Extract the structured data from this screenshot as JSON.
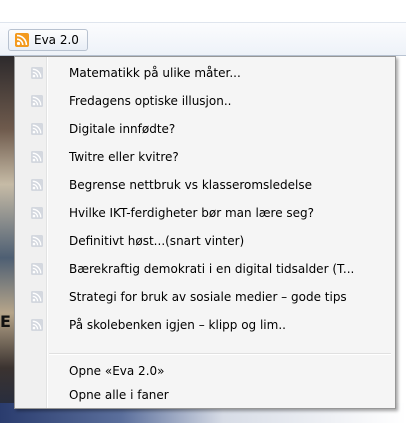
{
  "toolbar": {
    "folder_label": "Eva 2.0",
    "folder_icon": "rss-feed-icon"
  },
  "menu": {
    "items": [
      {
        "label": "Matematikk på ulike måter...",
        "icon": "rss-feed-icon"
      },
      {
        "label": "Fredagens optiske illusjon..",
        "icon": "rss-feed-icon"
      },
      {
        "label": "Digitale innfødte?",
        "icon": "rss-feed-icon"
      },
      {
        "label": "Twitre eller kvitre?",
        "icon": "rss-feed-icon"
      },
      {
        "label": "Begrense nettbruk vs klasseromsledelse",
        "icon": "rss-feed-icon"
      },
      {
        "label": "Hvilke IKT-ferdigheter bør man lære seg?",
        "icon": "rss-feed-icon"
      },
      {
        "label": "Definitivt høst...(snart vinter)",
        "icon": "rss-feed-icon"
      },
      {
        "label": "Bærekraftig demokrati i en digital tidsalder (T...",
        "icon": "rss-feed-icon"
      },
      {
        "label": "Strategi for bruk av sosiale medier – gode tips",
        "icon": "rss-feed-icon"
      },
      {
        "label": "På skolebenken igjen – klipp og lim..",
        "icon": "rss-feed-icon"
      }
    ],
    "actions": [
      {
        "label": "Opne «Eva 2.0»"
      },
      {
        "label": "Opne alle i faner"
      }
    ]
  },
  "background": {
    "partial_glyph": "E"
  },
  "colors": {
    "feed_icon_active": "#f39a1e",
    "feed_icon_inactive": "#c9ced6",
    "menu_bg": "#f5f5f5",
    "menu_border": "#979797"
  }
}
